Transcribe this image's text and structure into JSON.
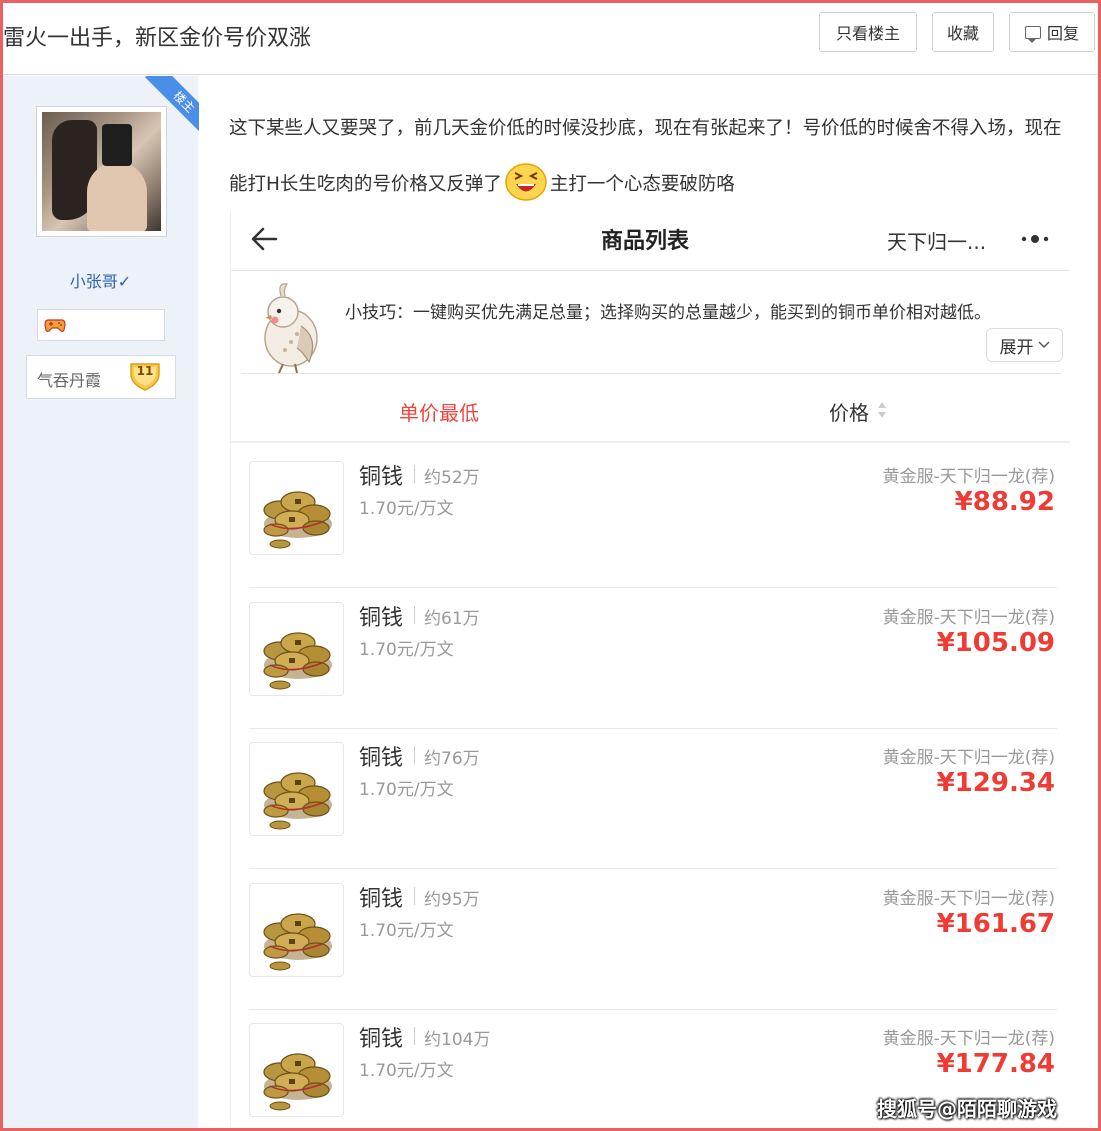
{
  "header": {
    "title": "雷火一出手，新区金价号价双涨",
    "buttons": {
      "only_owner": "只看楼主",
      "favorite": "收藏",
      "reply": "回复"
    }
  },
  "sidebar": {
    "owner_badge": "楼主",
    "username": "小张哥✓",
    "level_name": "气吞丹霞",
    "level_num": "11"
  },
  "post": {
    "text_part1": "这下某些人又要哭了，前几天金价低的时候没抄底，现在有张起来了！号价低的时候舍不得入场，现在能打H长生吃肉的号价格又反弹了",
    "text_part2": "主打一个心态要破防咯",
    "emoji": "laugh-emoji"
  },
  "screenshot": {
    "title": "商品列表",
    "server": "天下归一...",
    "tip": "小技巧：一键购买优先满足总量；选择购买的总量越少，能买到的铜币单价相对越低。",
    "expand": "展开",
    "sort_lowest": "单价最低",
    "sort_price": "价格",
    "accent": "#f03b35",
    "items": [
      {
        "name": "铜钱",
        "qty": "约52万",
        "unit": "1.70元/万文",
        "server": "黄金服-天下归一龙(荐)",
        "price": "¥88.92"
      },
      {
        "name": "铜钱",
        "qty": "约61万",
        "unit": "1.70元/万文",
        "server": "黄金服-天下归一龙(荐)",
        "price": "¥105.09"
      },
      {
        "name": "铜钱",
        "qty": "约76万",
        "unit": "1.70元/万文",
        "server": "黄金服-天下归一龙(荐)",
        "price": "¥129.34"
      },
      {
        "name": "铜钱",
        "qty": "约95万",
        "unit": "1.70元/万文",
        "server": "黄金服-天下归一龙(荐)",
        "price": "¥161.67"
      },
      {
        "name": "铜钱",
        "qty": "约104万",
        "unit": "1.70元/万文",
        "server": "黄金服-天下归一龙(荐)",
        "price": "¥177.84"
      }
    ]
  },
  "watermark": "搜狐号@陌陌聊游戏"
}
